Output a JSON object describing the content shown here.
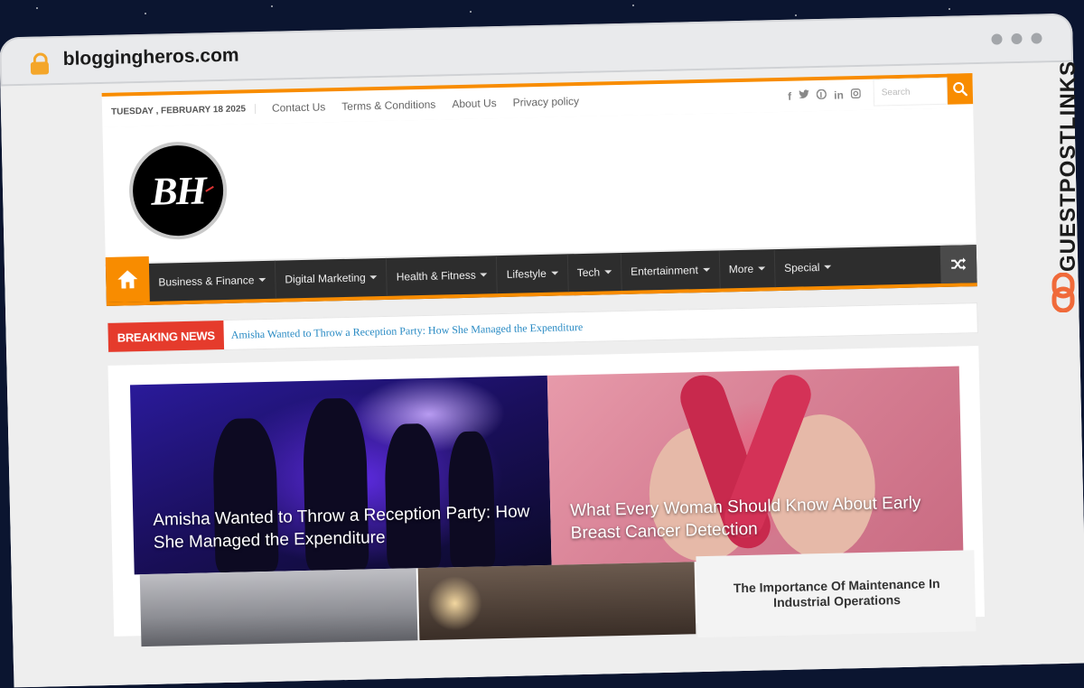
{
  "browser": {
    "domain": "bloggingheros.com"
  },
  "topbar": {
    "date": "TUESDAY , FEBRUARY 18 2025",
    "links": [
      "Contact Us",
      "Terms & Conditions",
      "About Us",
      "Privacy policy"
    ],
    "social_icons": [
      "facebook-icon",
      "twitter-icon",
      "pinterest-icon",
      "linkedin-icon",
      "instagram-icon"
    ],
    "search_placeholder": "Search"
  },
  "header": {
    "logo_text": "BH"
  },
  "nav": {
    "items": [
      "Business & Finance",
      "Digital Marketing",
      "Health & Fitness",
      "Lifestyle",
      "Tech",
      "Entertainment",
      "More",
      "Special"
    ]
  },
  "breaking": {
    "label": "BREAKING NEWS",
    "headline": "Amisha Wanted to Throw a Reception Party: How She Managed the Expenditure"
  },
  "featured": [
    {
      "title": "Amisha Wanted to Throw a Reception Party: How She Managed the Expenditure"
    },
    {
      "title": "What Every Woman Should Know About Early Breast Cancer Detection"
    }
  ],
  "side_card": {
    "title": "The Importance Of Maintenance In Industrial Operations"
  },
  "brand": {
    "name": "GUESTPOSTLINKS"
  },
  "colors": {
    "accent": "#f88c00",
    "nav_bg": "#2d2d2d",
    "breaking": "#e53b2c",
    "brand_orange": "#f06a3a"
  }
}
